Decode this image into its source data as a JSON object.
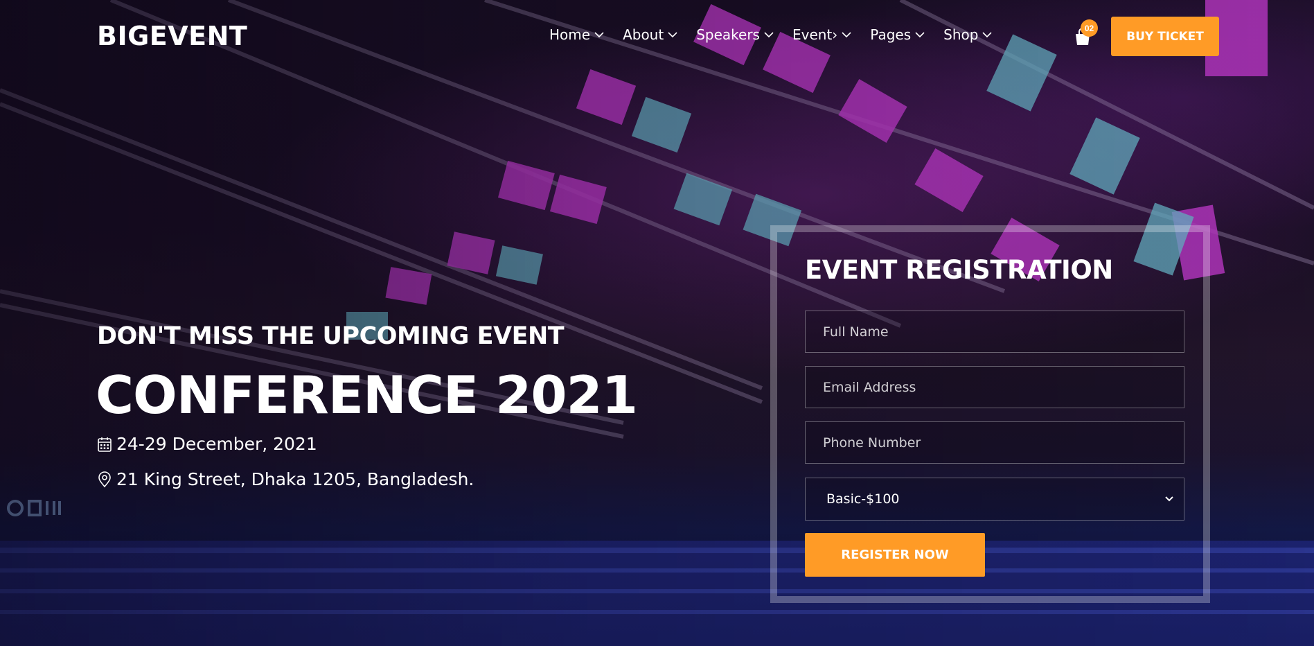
{
  "brand": {
    "logo": "BIGEVENT"
  },
  "nav": {
    "items": [
      {
        "label": "Home"
      },
      {
        "label": "About"
      },
      {
        "label": "Speakers"
      },
      {
        "label": "Event›"
      },
      {
        "label": "Pages"
      },
      {
        "label": "Shop"
      }
    ]
  },
  "cart": {
    "count": "02",
    "icon": "shopping-bag-icon"
  },
  "header": {
    "buy_label": "BUY TICKET"
  },
  "hero": {
    "subheading": "DON'T MISS THE UPCOMING EVENT",
    "heading": "CONFERENCE 2021",
    "date": "24-29 December, 2021",
    "location": "21 King Street, Dhaka 1205, Bangladesh."
  },
  "registration": {
    "title": "EVENT REGISTRATION",
    "name_placeholder": "Full Name",
    "email_placeholder": "Email Address",
    "phone_placeholder": "Phone Number",
    "ticket_selected": "Basic-$100",
    "submit_label": "REGISTER NOW"
  },
  "colors": {
    "accent": "#ff9b26",
    "text": "#ffffff"
  }
}
